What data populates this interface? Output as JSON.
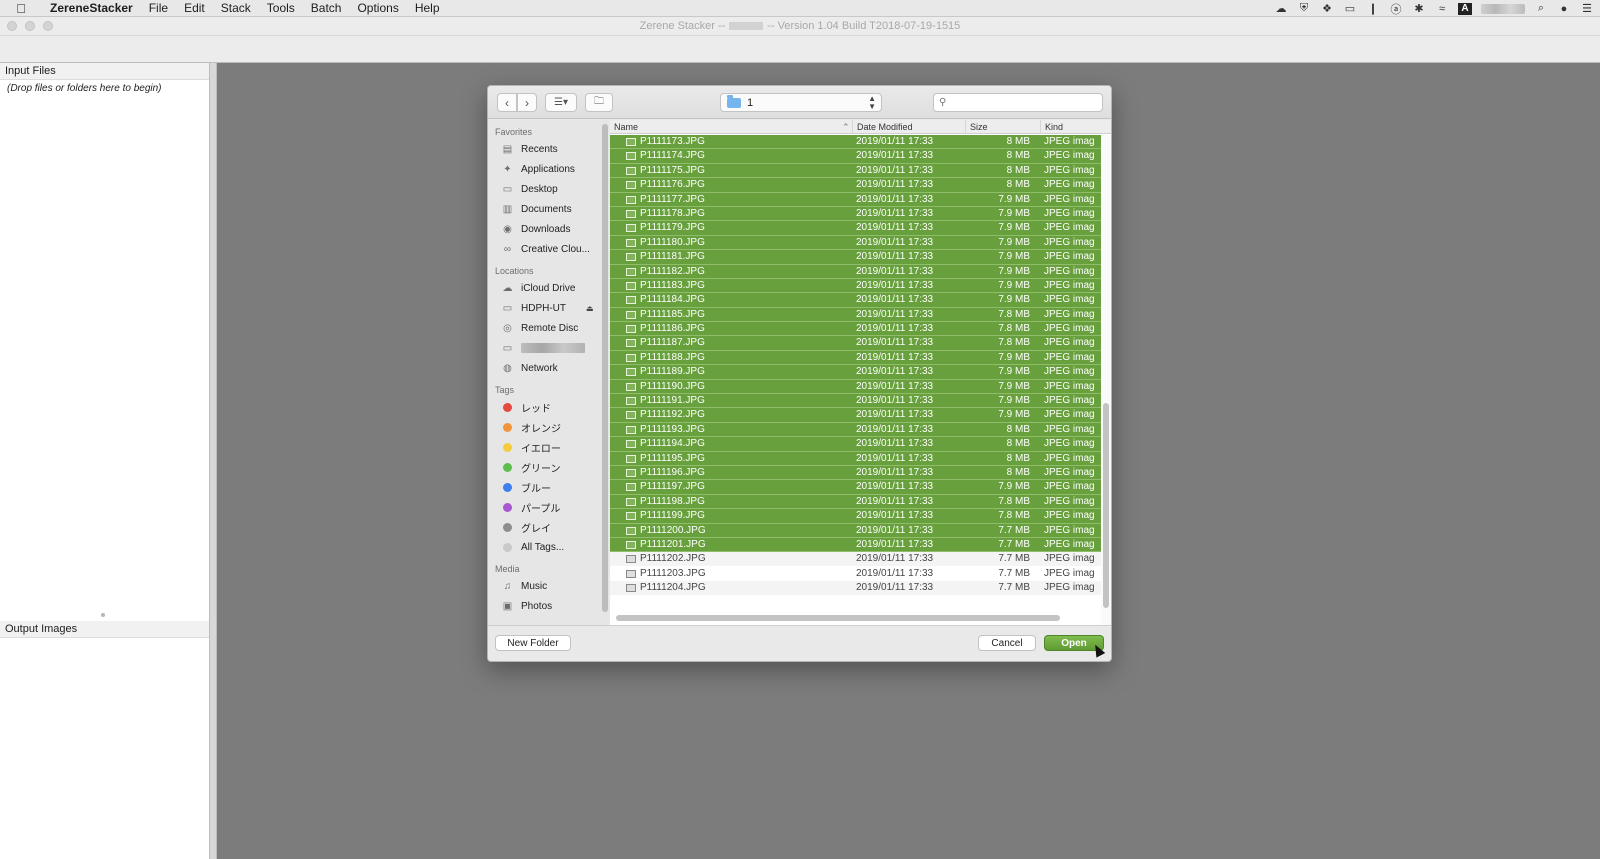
{
  "menubar": {
    "app_name": "ZereneStacker",
    "items": [
      "File",
      "Edit",
      "Stack",
      "Tools",
      "Batch",
      "Options",
      "Help"
    ],
    "status_icons": [
      "cloud-icon",
      "shield-icon",
      "dropbox-icon",
      "display-icon",
      "microphone-icon",
      "accessibility-icon",
      "bluetooth-icon",
      "wifi-icon",
      "input-method-icon",
      "spotlight-icon",
      "siri-icon",
      "notification-center-icon"
    ],
    "input_method_glyph": "A"
  },
  "window": {
    "title_prefix": "Zerene Stacker --",
    "title_suffix": "-- Version 1.04 Build T2018-07-19-1515"
  },
  "panes": {
    "input_files": "Input Files",
    "drop_hint": "(Drop files or folders here to begin)",
    "output_images": "Output Images"
  },
  "dialog": {
    "location": "1",
    "search_placeholder": "",
    "columns": {
      "name": "Name",
      "date": "Date Modified",
      "size": "Size",
      "kind": "Kind"
    },
    "sidebar": [
      {
        "section": "Favorites",
        "items": [
          {
            "label": "Recents",
            "icon": "recents-icon"
          },
          {
            "label": "Applications",
            "icon": "applications-icon"
          },
          {
            "label": "Desktop",
            "icon": "desktop-icon"
          },
          {
            "label": "Documents",
            "icon": "documents-icon"
          },
          {
            "label": "Downloads",
            "icon": "downloads-icon"
          },
          {
            "label": "Creative Clou...",
            "icon": "creative-cloud-icon"
          }
        ]
      },
      {
        "section": "Locations",
        "items": [
          {
            "label": "iCloud Drive",
            "icon": "icloud-icon"
          },
          {
            "label": "HDPH-UT",
            "icon": "drive-icon",
            "eject": true
          },
          {
            "label": "Remote Disc",
            "icon": "disc-icon"
          },
          {
            "label": "",
            "icon": "computer-icon",
            "blurred": true
          },
          {
            "label": "Network",
            "icon": "network-icon"
          }
        ]
      },
      {
        "section": "Tags",
        "items": [
          {
            "label": "レッド",
            "color": "#e5493f"
          },
          {
            "label": "オレンジ",
            "color": "#f2943a"
          },
          {
            "label": "イエロー",
            "color": "#f5cc3c"
          },
          {
            "label": "グリーン",
            "color": "#5dbf4d"
          },
          {
            "label": "ブルー",
            "color": "#3d7fef"
          },
          {
            "label": "パープル",
            "color": "#a658d2"
          },
          {
            "label": "グレイ",
            "color": "#8e8e8e"
          },
          {
            "label": "All Tags...",
            "color": "#c9c9c9"
          }
        ]
      },
      {
        "section": "Media",
        "items": [
          {
            "label": "Music",
            "icon": "music-icon"
          },
          {
            "label": "Photos",
            "icon": "photos-icon"
          }
        ]
      }
    ],
    "files": [
      {
        "name": "P1111173.JPG",
        "date": "2019/01/11 17:33",
        "size": "8 MB",
        "kind": "JPEG imag",
        "selected": true
      },
      {
        "name": "P1111174.JPG",
        "date": "2019/01/11 17:33",
        "size": "8 MB",
        "kind": "JPEG imag",
        "selected": true
      },
      {
        "name": "P1111175.JPG",
        "date": "2019/01/11 17:33",
        "size": "8 MB",
        "kind": "JPEG imag",
        "selected": true
      },
      {
        "name": "P1111176.JPG",
        "date": "2019/01/11 17:33",
        "size": "8 MB",
        "kind": "JPEG imag",
        "selected": true
      },
      {
        "name": "P1111177.JPG",
        "date": "2019/01/11 17:33",
        "size": "7.9 MB",
        "kind": "JPEG imag",
        "selected": true
      },
      {
        "name": "P1111178.JPG",
        "date": "2019/01/11 17:33",
        "size": "7.9 MB",
        "kind": "JPEG imag",
        "selected": true
      },
      {
        "name": "P1111179.JPG",
        "date": "2019/01/11 17:33",
        "size": "7.9 MB",
        "kind": "JPEG imag",
        "selected": true
      },
      {
        "name": "P1111180.JPG",
        "date": "2019/01/11 17:33",
        "size": "7.9 MB",
        "kind": "JPEG imag",
        "selected": true
      },
      {
        "name": "P1111181.JPG",
        "date": "2019/01/11 17:33",
        "size": "7.9 MB",
        "kind": "JPEG imag",
        "selected": true
      },
      {
        "name": "P1111182.JPG",
        "date": "2019/01/11 17:33",
        "size": "7.9 MB",
        "kind": "JPEG imag",
        "selected": true
      },
      {
        "name": "P1111183.JPG",
        "date": "2019/01/11 17:33",
        "size": "7.9 MB",
        "kind": "JPEG imag",
        "selected": true
      },
      {
        "name": "P1111184.JPG",
        "date": "2019/01/11 17:33",
        "size": "7.9 MB",
        "kind": "JPEG imag",
        "selected": true
      },
      {
        "name": "P1111185.JPG",
        "date": "2019/01/11 17:33",
        "size": "7.8 MB",
        "kind": "JPEG imag",
        "selected": true
      },
      {
        "name": "P1111186.JPG",
        "date": "2019/01/11 17:33",
        "size": "7.8 MB",
        "kind": "JPEG imag",
        "selected": true
      },
      {
        "name": "P1111187.JPG",
        "date": "2019/01/11 17:33",
        "size": "7.8 MB",
        "kind": "JPEG imag",
        "selected": true
      },
      {
        "name": "P1111188.JPG",
        "date": "2019/01/11 17:33",
        "size": "7.9 MB",
        "kind": "JPEG imag",
        "selected": true
      },
      {
        "name": "P1111189.JPG",
        "date": "2019/01/11 17:33",
        "size": "7.9 MB",
        "kind": "JPEG imag",
        "selected": true
      },
      {
        "name": "P1111190.JPG",
        "date": "2019/01/11 17:33",
        "size": "7.9 MB",
        "kind": "JPEG imag",
        "selected": true
      },
      {
        "name": "P1111191.JPG",
        "date": "2019/01/11 17:33",
        "size": "7.9 MB",
        "kind": "JPEG imag",
        "selected": true
      },
      {
        "name": "P1111192.JPG",
        "date": "2019/01/11 17:33",
        "size": "7.9 MB",
        "kind": "JPEG imag",
        "selected": true
      },
      {
        "name": "P1111193.JPG",
        "date": "2019/01/11 17:33",
        "size": "8 MB",
        "kind": "JPEG imag",
        "selected": true
      },
      {
        "name": "P1111194.JPG",
        "date": "2019/01/11 17:33",
        "size": "8 MB",
        "kind": "JPEG imag",
        "selected": true
      },
      {
        "name": "P1111195.JPG",
        "date": "2019/01/11 17:33",
        "size": "8 MB",
        "kind": "JPEG imag",
        "selected": true
      },
      {
        "name": "P1111196.JPG",
        "date": "2019/01/11 17:33",
        "size": "8 MB",
        "kind": "JPEG imag",
        "selected": true
      },
      {
        "name": "P1111197.JPG",
        "date": "2019/01/11 17:33",
        "size": "7.9 MB",
        "kind": "JPEG imag",
        "selected": true
      },
      {
        "name": "P1111198.JPG",
        "date": "2019/01/11 17:33",
        "size": "7.8 MB",
        "kind": "JPEG imag",
        "selected": true
      },
      {
        "name": "P1111199.JPG",
        "date": "2019/01/11 17:33",
        "size": "7.8 MB",
        "kind": "JPEG imag",
        "selected": true
      },
      {
        "name": "P1111200.JPG",
        "date": "2019/01/11 17:33",
        "size": "7.7 MB",
        "kind": "JPEG imag",
        "selected": true
      },
      {
        "name": "P1111201.JPG",
        "date": "2019/01/11 17:33",
        "size": "7.7 MB",
        "kind": "JPEG imag",
        "selected": true
      },
      {
        "name": "P1111202.JPG",
        "date": "2019/01/11 17:33",
        "size": "7.7 MB",
        "kind": "JPEG imag",
        "selected": false
      },
      {
        "name": "P1111203.JPG",
        "date": "2019/01/11 17:33",
        "size": "7.7 MB",
        "kind": "JPEG imag",
        "selected": false
      },
      {
        "name": "P1111204.JPG",
        "date": "2019/01/11 17:33",
        "size": "7.7 MB",
        "kind": "JPEG imag",
        "selected": false
      }
    ],
    "buttons": {
      "new_folder": "New Folder",
      "cancel": "Cancel",
      "open": "Open"
    }
  },
  "colors": {
    "selection": "#67a03c",
    "accent": "#5f9a33",
    "folder": "#74b5ee"
  }
}
